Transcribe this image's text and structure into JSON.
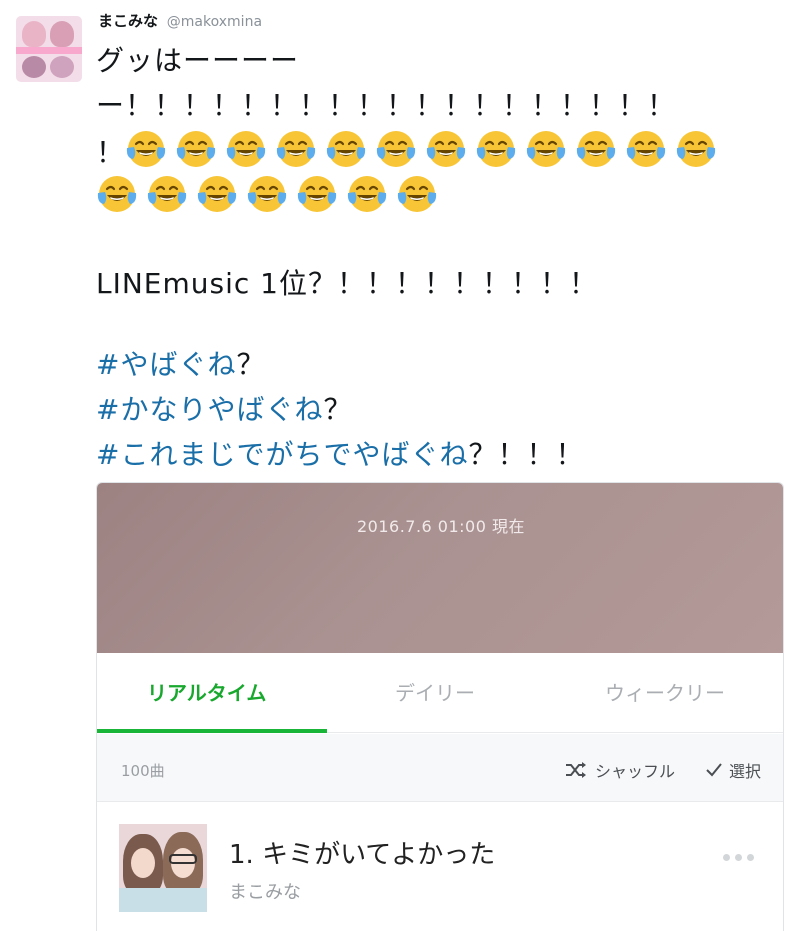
{
  "tweet": {
    "user_name": "まこみな",
    "user_handle": "@makoxmina",
    "lines": [
      "グッはーーーー",
      "ー！！！！！！！！！！！！！！！！！！！",
      "！"
    ],
    "line4": "LINEmusic 1位？！！！！！！！！！",
    "hashtag1": "#やばぐね",
    "hashtag1_suffix": "？",
    "hashtag2": "#かなりやばぐね",
    "hashtag2_suffix": "？",
    "hashtag3": "#これまじでがちでやばぐね",
    "hashtag3_suffix": "？！！！",
    "emoji_icon": "face-with-tears-of-joy-icon",
    "emoji_row1_count": 12,
    "emoji_row2_count": 7
  },
  "card": {
    "banner_text": "2016.7.6 01:00 現在",
    "tabs": [
      "リアルタイム",
      "デイリー",
      "ウィークリー"
    ],
    "active_tab": "リアルタイム",
    "track_count": "100曲",
    "shuffle_label": "シャッフル",
    "shuffle_icon": "shuffle-icon",
    "select_label": "選択",
    "select_icon": "checkmark-icon",
    "track": {
      "title": "1. キミがいてよかった",
      "artist": "まこみな",
      "more_icon": "more-dots-icon"
    }
  },
  "colors": {
    "hashtag": "#1b6fa8",
    "tab_active": "#19a82e",
    "banner": "#a99291"
  }
}
